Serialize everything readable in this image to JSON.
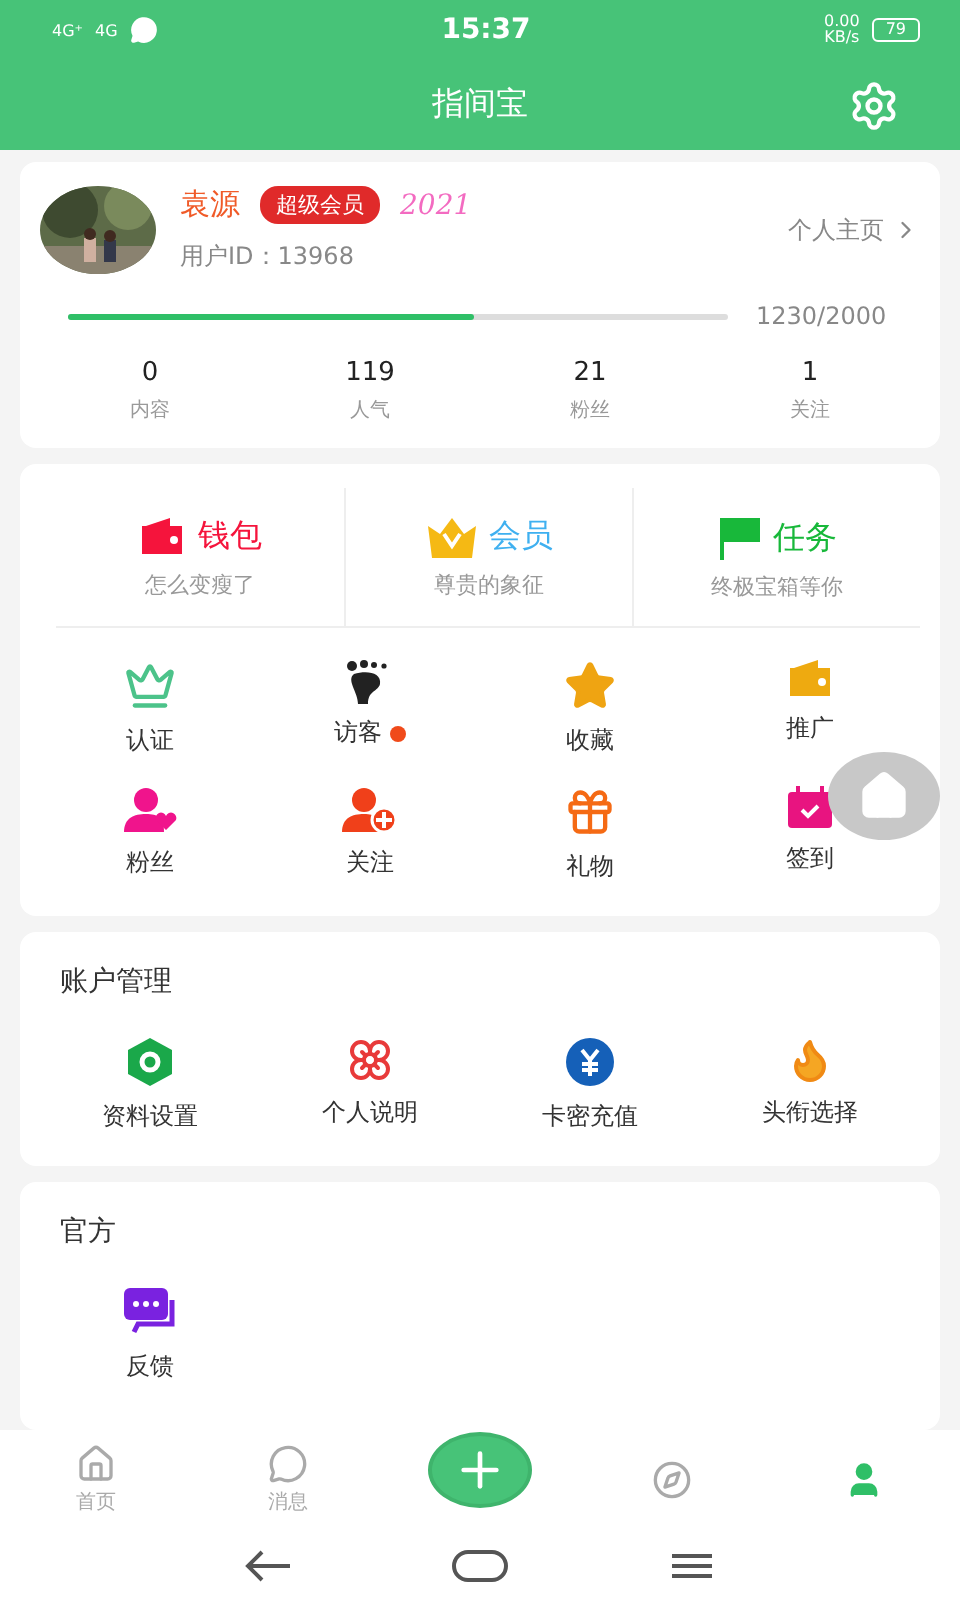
{
  "status_bar": {
    "networks": [
      "4G⁺",
      "4G"
    ],
    "time": "15:37",
    "speed": "0.00",
    "speed_unit": "KB/s",
    "battery": "79"
  },
  "header": {
    "title": "指间宝"
  },
  "profile": {
    "name": "袁源",
    "badge": "超级会员",
    "year_tag": "2021",
    "user_id": "用户ID：13968",
    "homepage_link": "个人主页",
    "progress": {
      "level": 0.615,
      "reading": "1230/2000"
    },
    "stats": [
      {
        "value": "0",
        "label": "内容"
      },
      {
        "value": "119",
        "label": "人气"
      },
      {
        "value": "21",
        "label": "粉丝"
      },
      {
        "value": "1",
        "label": "关注"
      }
    ]
  },
  "features": [
    {
      "kind": "wallet",
      "title": "钱包",
      "subtitle": "怎么变瘦了",
      "color": "#f5143c"
    },
    {
      "kind": "vip",
      "title": "会员",
      "subtitle": "尊贵的象征",
      "color": "#3fb0f0"
    },
    {
      "kind": "task",
      "title": "任务",
      "subtitle": "终极宝箱等你",
      "color": "#18b83a"
    }
  ],
  "shortcuts": [
    {
      "kind": "crown",
      "label": "认证",
      "dot": false
    },
    {
      "kind": "foot",
      "label": "访客",
      "dot": true
    },
    {
      "kind": "star",
      "label": "收藏",
      "dot": false
    },
    {
      "kind": "wallet",
      "label": "推广",
      "dot": false
    },
    {
      "kind": "fan",
      "label": "粉丝",
      "dot": false
    },
    {
      "kind": "follow",
      "label": "关注",
      "dot": false
    },
    {
      "kind": "gift",
      "label": "礼物",
      "dot": false
    },
    {
      "kind": "checkin",
      "label": "签到",
      "dot": false
    }
  ],
  "account": {
    "title": "账户管理",
    "items": [
      {
        "kind": "settings",
        "label": "资料设置"
      },
      {
        "kind": "flower",
        "label": "个人说明"
      },
      {
        "kind": "recharge",
        "label": "卡密充值"
      },
      {
        "kind": "fire",
        "label": "头衔选择"
      }
    ]
  },
  "official": {
    "title": "官方",
    "items": [
      {
        "kind": "feedback",
        "label": "反馈"
      }
    ]
  },
  "tab_bar": [
    {
      "kind": "home",
      "label": "首页",
      "selected": false
    },
    {
      "kind": "message",
      "label": "消息",
      "selected": false
    },
    {
      "kind": "add",
      "selected": false
    },
    {
      "kind": "discover",
      "selected": false
    },
    {
      "kind": "me",
      "selected": true
    }
  ]
}
